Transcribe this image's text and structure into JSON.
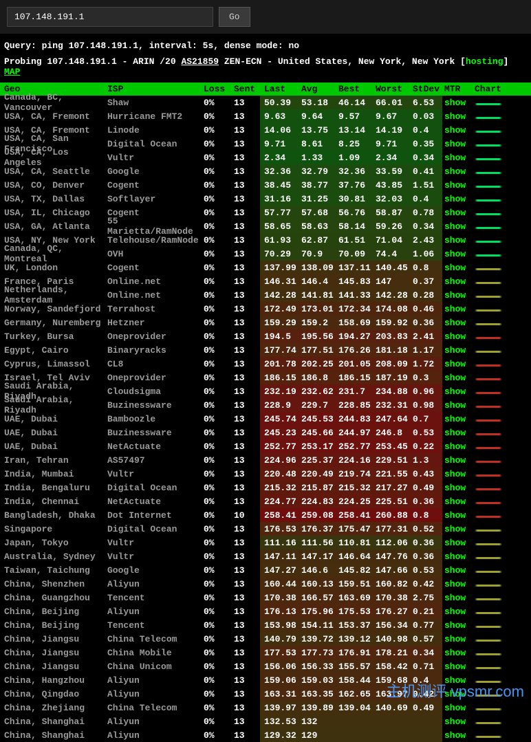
{
  "search": {
    "value": "107.148.191.1",
    "go_label": "Go"
  },
  "query_line": "Query: ping 107.148.191.1, interval: 5s, dense mode: no",
  "probe": {
    "prefix": "Probing 107.148.191.1 - ARIN /20 ",
    "asn": "AS21859",
    "mid": " ZEN-ECN - United States, New York, New York [",
    "hosting": "hosting",
    "suffix": "] ",
    "map": "MAP"
  },
  "headers": {
    "geo": "Geo",
    "isp": "ISP",
    "loss": "Loss",
    "sent": "Sent",
    "last": "Last",
    "avg": "Avg",
    "best": "Best",
    "worst": "Worst",
    "stdev": "StDev",
    "mtr": "MTR",
    "chart": "Chart"
  },
  "mtr_label": "show",
  "rows": [
    {
      "geo": "Canada, BC, Vancouver",
      "isp": "Shaw",
      "loss": "0%",
      "sent": "13",
      "last": "50.39",
      "avg": "53.18",
      "best": "46.14",
      "worst": "66.01",
      "stdev": "6.53"
    },
    {
      "geo": "USA, CA, Fremont",
      "isp": "Hurricane FMT2",
      "loss": "0%",
      "sent": "13",
      "last": "9.63",
      "avg": "9.64",
      "best": "9.57",
      "worst": "9.67",
      "stdev": "0.03"
    },
    {
      "geo": "USA, CA, Fremont",
      "isp": "Linode",
      "loss": "0%",
      "sent": "13",
      "last": "14.06",
      "avg": "13.75",
      "best": "13.14",
      "worst": "14.19",
      "stdev": "0.4"
    },
    {
      "geo": "USA, CA, San Francisco",
      "isp": "Digital Ocean",
      "loss": "0%",
      "sent": "13",
      "last": "9.71",
      "avg": "8.61",
      "best": "8.25",
      "worst": "9.71",
      "stdev": "0.35"
    },
    {
      "geo": "USA, CA, Los Angeles",
      "isp": "Vultr",
      "loss": "0%",
      "sent": "13",
      "last": "2.34",
      "avg": "1.33",
      "best": "1.09",
      "worst": "2.34",
      "stdev": "0.34"
    },
    {
      "geo": "USA, CA, Seattle",
      "isp": "Google",
      "loss": "0%",
      "sent": "13",
      "last": "32.36",
      "avg": "32.79",
      "best": "32.36",
      "worst": "33.59",
      "stdev": "0.41"
    },
    {
      "geo": "USA, CO, Denver",
      "isp": "Cogent",
      "loss": "0%",
      "sent": "13",
      "last": "38.45",
      "avg": "38.77",
      "best": "37.76",
      "worst": "43.85",
      "stdev": "1.51"
    },
    {
      "geo": "USA, TX, Dallas",
      "isp": "Softlayer",
      "loss": "0%",
      "sent": "13",
      "last": "31.16",
      "avg": "31.25",
      "best": "30.81",
      "worst": "32.03",
      "stdev": "0.4"
    },
    {
      "geo": "USA, IL, Chicago",
      "isp": "Cogent",
      "loss": "0%",
      "sent": "13",
      "last": "57.77",
      "avg": "57.68",
      "best": "56.76",
      "worst": "58.87",
      "stdev": "0.78"
    },
    {
      "geo": "USA, GA, Atlanta",
      "isp": "55 Marietta/RamNode",
      "loss": "0%",
      "sent": "13",
      "last": "58.65",
      "avg": "58.63",
      "best": "58.14",
      "worst": "59.26",
      "stdev": "0.34"
    },
    {
      "geo": "USA, NY, New York",
      "isp": "Telehouse/RamNode",
      "loss": "0%",
      "sent": "13",
      "last": "61.93",
      "avg": "62.87",
      "best": "61.51",
      "worst": "71.04",
      "stdev": "2.43"
    },
    {
      "geo": "Canada, QC, Montreal",
      "isp": "OVH",
      "loss": "0%",
      "sent": "13",
      "last": "70.29",
      "avg": "70.9",
      "best": "70.09",
      "worst": "74.4",
      "stdev": "1.06"
    },
    {
      "geo": "UK, London",
      "isp": "Cogent",
      "loss": "0%",
      "sent": "13",
      "last": "137.99",
      "avg": "138.09",
      "best": "137.11",
      "worst": "140.45",
      "stdev": "0.8"
    },
    {
      "geo": "France, Paris",
      "isp": "Online.net",
      "loss": "0%",
      "sent": "13",
      "last": "146.31",
      "avg": "146.4",
      "best": "145.83",
      "worst": "147",
      "stdev": "0.37"
    },
    {
      "geo": "Netherlands, Amsterdam",
      "isp": "Online.net",
      "loss": "0%",
      "sent": "13",
      "last": "142.28",
      "avg": "141.81",
      "best": "141.33",
      "worst": "142.28",
      "stdev": "0.28"
    },
    {
      "geo": "Norway, Sandefjord",
      "isp": "Terrahost",
      "loss": "0%",
      "sent": "13",
      "last": "172.49",
      "avg": "173.01",
      "best": "172.34",
      "worst": "174.08",
      "stdev": "0.46"
    },
    {
      "geo": "Germany, Nuremberg",
      "isp": "Hetzner",
      "loss": "0%",
      "sent": "13",
      "last": "159.29",
      "avg": "159.2",
      "best": "158.69",
      "worst": "159.92",
      "stdev": "0.36"
    },
    {
      "geo": "Turkey, Bursa",
      "isp": "Oneprovider",
      "loss": "0%",
      "sent": "13",
      "last": "194.5",
      "avg": "195.56",
      "best": "194.27",
      "worst": "203.83",
      "stdev": "2.41"
    },
    {
      "geo": "Egypt, Cairo",
      "isp": "Binaryracks",
      "loss": "0%",
      "sent": "13",
      "last": "177.74",
      "avg": "177.51",
      "best": "176.26",
      "worst": "181.18",
      "stdev": "1.17"
    },
    {
      "geo": "Cyprus, Limassol",
      "isp": "CL8",
      "loss": "0%",
      "sent": "13",
      "last": "201.78",
      "avg": "202.25",
      "best": "201.05",
      "worst": "208.09",
      "stdev": "1.72"
    },
    {
      "geo": "Israel, Tel Aviv",
      "isp": "Oneprovider",
      "loss": "0%",
      "sent": "13",
      "last": "186.15",
      "avg": "186.8",
      "best": "186.15",
      "worst": "187.19",
      "stdev": "0.3"
    },
    {
      "geo": "Saudi Arabia, Riyadh",
      "isp": "Cloudsigma",
      "loss": "0%",
      "sent": "13",
      "last": "232.19",
      "avg": "232.62",
      "best": "231.7",
      "worst": "234.88",
      "stdev": "0.96"
    },
    {
      "geo": "Saudi Arabia, Riyadh",
      "isp": "Buzinessware",
      "loss": "0%",
      "sent": "13",
      "last": "228.9",
      "avg": "229.7",
      "best": "228.85",
      "worst": "232.31",
      "stdev": "0.98"
    },
    {
      "geo": "UAE, Dubai",
      "isp": "Bamboozle",
      "loss": "0%",
      "sent": "13",
      "last": "245.74",
      "avg": "245.53",
      "best": "244.83",
      "worst": "247.64",
      "stdev": "0.7"
    },
    {
      "geo": "UAE, Dubai",
      "isp": "Buzinessware",
      "loss": "0%",
      "sent": "13",
      "last": "245.23",
      "avg": "245.66",
      "best": "244.97",
      "worst": "246.8",
      "stdev": "0.53"
    },
    {
      "geo": "UAE, Dubai",
      "isp": "NetActuate",
      "loss": "0%",
      "sent": "13",
      "last": "252.77",
      "avg": "253.17",
      "best": "252.77",
      "worst": "253.45",
      "stdev": "0.22"
    },
    {
      "geo": "Iran, Tehran",
      "isp": "AS57497",
      "loss": "0%",
      "sent": "13",
      "last": "224.96",
      "avg": "225.37",
      "best": "224.16",
      "worst": "229.51",
      "stdev": "1.3"
    },
    {
      "geo": "India, Mumbai",
      "isp": "Vultr",
      "loss": "0%",
      "sent": "13",
      "last": "220.48",
      "avg": "220.49",
      "best": "219.74",
      "worst": "221.55",
      "stdev": "0.43"
    },
    {
      "geo": "India, Bengaluru",
      "isp": "Digital Ocean",
      "loss": "0%",
      "sent": "13",
      "last": "215.32",
      "avg": "215.87",
      "best": "215.32",
      "worst": "217.27",
      "stdev": "0.49"
    },
    {
      "geo": "India, Chennai",
      "isp": "NetActuate",
      "loss": "0%",
      "sent": "13",
      "last": "224.77",
      "avg": "224.83",
      "best": "224.25",
      "worst": "225.51",
      "stdev": "0.36"
    },
    {
      "geo": "Bangladesh, Dhaka",
      "isp": "Dot Internet",
      "loss": "0%",
      "sent": "10",
      "last": "258.41",
      "avg": "259.08",
      "best": "258.41",
      "worst": "260.88",
      "stdev": "0.8"
    },
    {
      "geo": "Singapore",
      "isp": "Digital Ocean",
      "loss": "0%",
      "sent": "13",
      "last": "176.53",
      "avg": "176.37",
      "best": "175.47",
      "worst": "177.31",
      "stdev": "0.52"
    },
    {
      "geo": "Japan, Tokyo",
      "isp": "Vultr",
      "loss": "0%",
      "sent": "13",
      "last": "111.16",
      "avg": "111.56",
      "best": "110.81",
      "worst": "112.06",
      "stdev": "0.36"
    },
    {
      "geo": "Australia, Sydney",
      "isp": "Vultr",
      "loss": "0%",
      "sent": "13",
      "last": "147.11",
      "avg": "147.17",
      "best": "146.64",
      "worst": "147.76",
      "stdev": "0.36"
    },
    {
      "geo": "Taiwan, Taichung",
      "isp": "Google",
      "loss": "0%",
      "sent": "13",
      "last": "147.27",
      "avg": "146.6",
      "best": "145.82",
      "worst": "147.66",
      "stdev": "0.53"
    },
    {
      "geo": "China, Shenzhen",
      "isp": "Aliyun",
      "loss": "0%",
      "sent": "13",
      "last": "160.44",
      "avg": "160.13",
      "best": "159.51",
      "worst": "160.82",
      "stdev": "0.42"
    },
    {
      "geo": "China, Guangzhou",
      "isp": "Tencent",
      "loss": "0%",
      "sent": "13",
      "last": "170.38",
      "avg": "166.57",
      "best": "163.69",
      "worst": "170.38",
      "stdev": "2.75"
    },
    {
      "geo": "China, Beijing",
      "isp": "Aliyun",
      "loss": "0%",
      "sent": "13",
      "last": "176.13",
      "avg": "175.96",
      "best": "175.53",
      "worst": "176.27",
      "stdev": "0.21"
    },
    {
      "geo": "China, Beijing",
      "isp": "Tencent",
      "loss": "0%",
      "sent": "13",
      "last": "153.98",
      "avg": "154.11",
      "best": "153.37",
      "worst": "156.34",
      "stdev": "0.77"
    },
    {
      "geo": "China, Jiangsu",
      "isp": "China Telecom",
      "loss": "0%",
      "sent": "13",
      "last": "140.79",
      "avg": "139.72",
      "best": "139.12",
      "worst": "140.98",
      "stdev": "0.57"
    },
    {
      "geo": "China, Jiangsu",
      "isp": "China Mobile",
      "loss": "0%",
      "sent": "13",
      "last": "177.53",
      "avg": "177.73",
      "best": "176.91",
      "worst": "178.21",
      "stdev": "0.34"
    },
    {
      "geo": "China, Jiangsu",
      "isp": "China Unicom",
      "loss": "0%",
      "sent": "13",
      "last": "156.06",
      "avg": "156.33",
      "best": "155.57",
      "worst": "158.42",
      "stdev": "0.71"
    },
    {
      "geo": "China, Hangzhou",
      "isp": "Aliyun",
      "loss": "0%",
      "sent": "13",
      "last": "159.06",
      "avg": "159.03",
      "best": "158.44",
      "worst": "159.68",
      "stdev": "0.4"
    },
    {
      "geo": "China, Qingdao",
      "isp": "Aliyun",
      "loss": "0%",
      "sent": "13",
      "last": "163.31",
      "avg": "163.35",
      "best": "162.65",
      "worst": "163.97",
      "stdev": "0.42"
    },
    {
      "geo": "China, Zhejiang",
      "isp": "China Telecom",
      "loss": "0%",
      "sent": "13",
      "last": "139.97",
      "avg": "139.89",
      "best": "139.04",
      "worst": "140.69",
      "stdev": "0.49"
    },
    {
      "geo": "China, Shanghai",
      "isp": "Aliyun",
      "loss": "0%",
      "sent": "13",
      "last": "132.53",
      "avg": "132",
      "best": "",
      "worst": "",
      "stdev": ""
    },
    {
      "geo": "China, Shanghai",
      "isp": "Aliyun",
      "loss": "0%",
      "sent": "13",
      "last": "129.32",
      "avg": "129",
      "best": "",
      "worst": "",
      "stdev": ""
    }
  ],
  "watermark": "主机测评 vpsmr.com"
}
